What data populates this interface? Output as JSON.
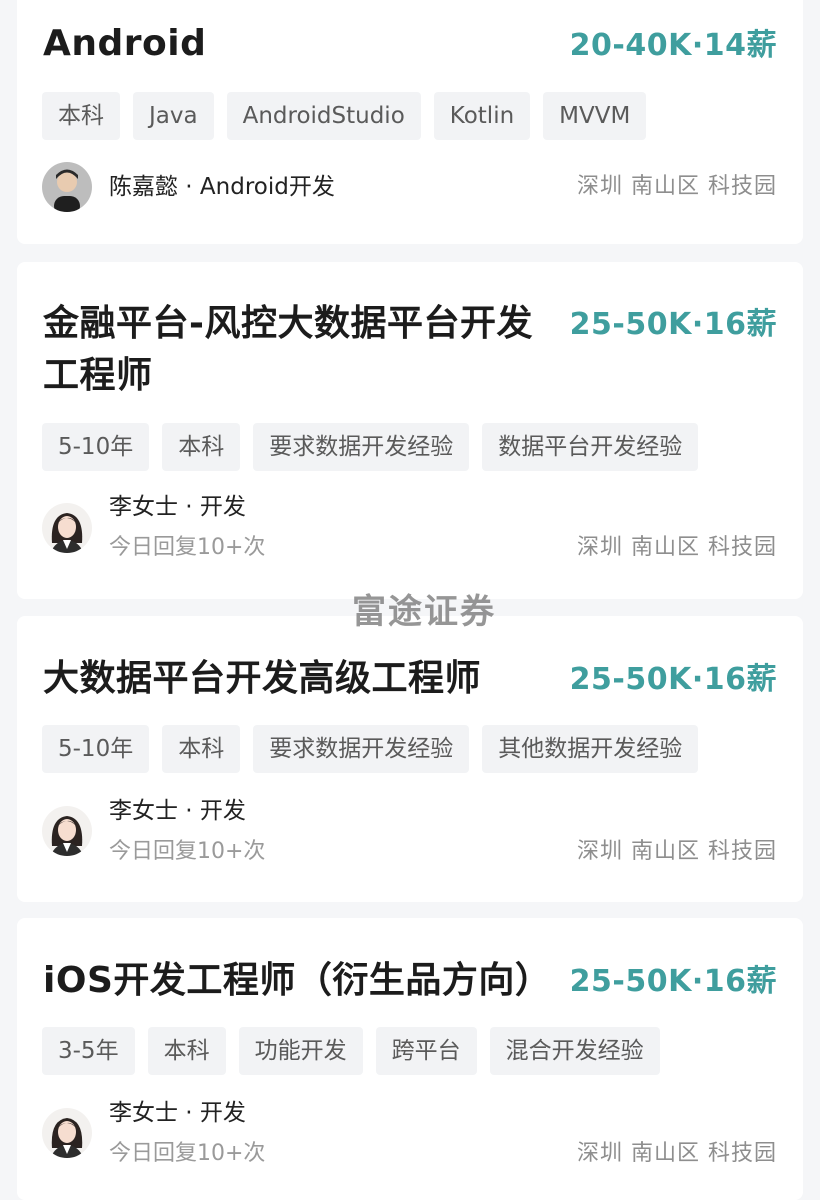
{
  "jobs": [
    {
      "title": "Android",
      "salary": "20-40K·14薪",
      "tags": [
        "本科",
        "Java",
        "AndroidStudio",
        "Kotlin",
        "MVVM"
      ],
      "recruiter": "陈嘉懿 · Android开发",
      "reply": "",
      "location": "深圳 南山区 科技园",
      "avatar": "male-avatar-photo"
    },
    {
      "title_line1": "金融平台-风控大数据平台开发",
      "title_line2": "工程师",
      "salary": "25-50K·16薪",
      "tags": [
        "5-10年",
        "本科",
        "要求数据开发经验",
        "数据平台开发经验"
      ],
      "recruiter": "李女士 · 开发",
      "reply": "今日回复10+次",
      "location": "深圳 南山区 科技园",
      "avatar": "female-avatar-cartoon"
    },
    {
      "title": "大数据平台开发高级工程师",
      "salary": "25-50K·16薪",
      "tags": [
        "5-10年",
        "本科",
        "要求数据开发经验",
        "其他数据开发经验"
      ],
      "recruiter": "李女士 · 开发",
      "reply": "今日回复10+次",
      "location": "深圳 南山区 科技园",
      "avatar": "female-avatar-cartoon"
    },
    {
      "title": "iOS开发工程师（衍生品方向）",
      "salary": "25-50K·16薪",
      "tags": [
        "3-5年",
        "本科",
        "功能开发",
        "跨平台",
        "混合开发经验"
      ],
      "recruiter": "李女士 · 开发",
      "reply": "今日回复10+次",
      "location": "深圳 南山区 科技园",
      "avatar": "female-avatar-cartoon"
    }
  ],
  "watermark": "富途证券",
  "colors": {
    "salary": "#3f9e9e",
    "tag_bg": "#f2f3f5",
    "page_bg": "#f5f6f8"
  }
}
